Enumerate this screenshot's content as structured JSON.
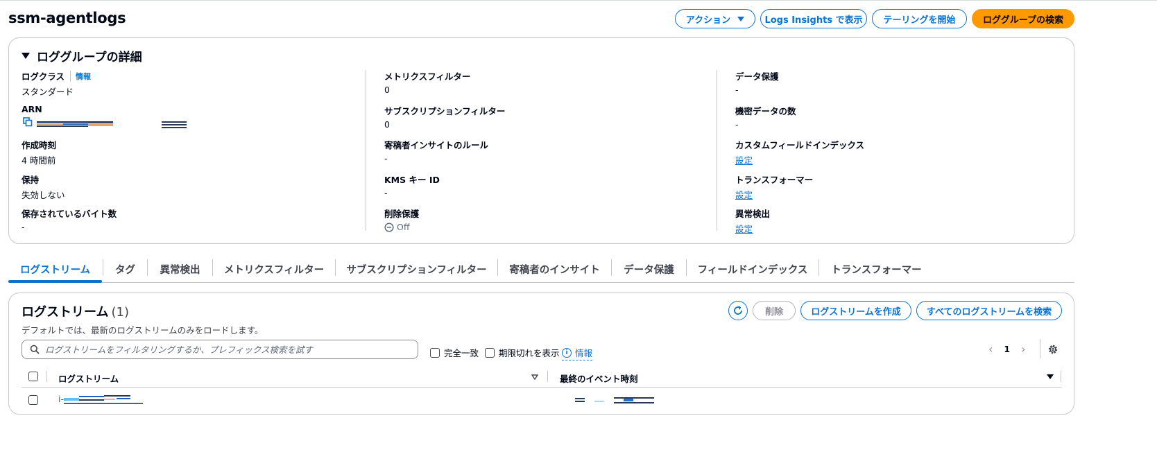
{
  "page": {
    "title": "ssm-agentlogs",
    "actions": [
      {
        "label": "アクション",
        "has_caret": true
      },
      {
        "label": "Logs Insights で表示"
      },
      {
        "label": "テーリングを開始"
      },
      {
        "label": "ロググループの検索",
        "primary": true
      }
    ]
  },
  "details": {
    "title": "ロググループの詳細",
    "col1": {
      "log_class_label": "ログクラス",
      "log_class_info": "情報",
      "log_class_value": "スタンダード",
      "arn_label": "ARN",
      "created_label": "作成時刻",
      "created_value": "4 時間前",
      "retention_label": "保持",
      "retention_value": "失効しない",
      "stored_bytes_label": "保存されているバイト数",
      "stored_bytes_value": "-"
    },
    "col2": {
      "metric_filters_label": "メトリクスフィルター",
      "metric_filters_value": "0",
      "subscription_filters_label": "サブスクリプションフィルター",
      "subscription_filters_value": "0",
      "contributor_label": "寄稿者インサイトのルール",
      "contributor_value": "-",
      "kms_label": "KMS キー ID",
      "kms_value": "-",
      "deletion_protection_label": "削除保護",
      "deletion_protection_value": "Off"
    },
    "col3": {
      "data_protection_label": "データ保護",
      "data_protection_value": "-",
      "sensitive_count_label": "機密データの数",
      "sensitive_count_value": "-",
      "custom_index_label": "カスタムフィールドインデックス",
      "custom_index_value": "設定",
      "transformer_label": "トランスフォーマー",
      "transformer_value": "設定",
      "anomaly_label": "異常検出",
      "anomaly_value": "設定"
    }
  },
  "tabs": [
    {
      "label": "ログストリーム",
      "active": true
    },
    {
      "label": "タグ"
    },
    {
      "label": "異常検出"
    },
    {
      "label": "メトリクスフィルター"
    },
    {
      "label": "サブスクリプションフィルター"
    },
    {
      "label": "寄稿者のインサイト"
    },
    {
      "label": "データ保護"
    },
    {
      "label": "フィールドインデックス"
    },
    {
      "label": "トランスフォーマー"
    }
  ],
  "streams": {
    "title": "ログストリーム",
    "count": "(1)",
    "description": "デフォルトでは、最新のログストリームのみをロードします。",
    "buttons": {
      "delete": "削除",
      "create": "ログストリームを作成",
      "search_all": "すべてのログストリームを検索"
    },
    "search_placeholder": "ログストリームをフィルタリングするか、プレフィックス検索を試す",
    "exact_match_label": "完全一致",
    "show_expired_label": "期限切れを表示",
    "info_label": "情報",
    "page_number": "1",
    "columns": {
      "stream": "ログストリーム",
      "last_event": "最終のイベント時刻"
    },
    "rows": [
      {
        "name_prefix": "i-"
      }
    ]
  },
  "colors": {
    "accent": "#0972d3",
    "primary_button": "#ff9900",
    "border": "#c6c6cd"
  }
}
